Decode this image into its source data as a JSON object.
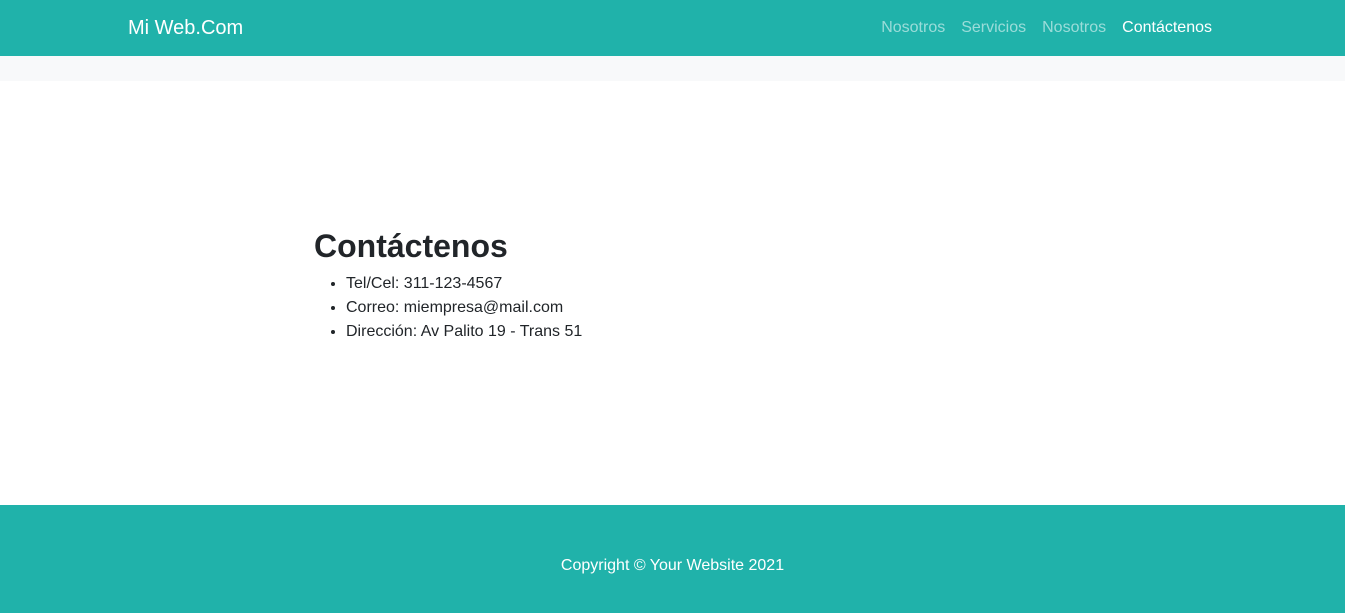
{
  "colors": {
    "brand_bar": "#20b2aa",
    "sub_bar": "#f8f9fa",
    "text": "#212529"
  },
  "navbar": {
    "brand": "Mi Web.Com",
    "links": [
      {
        "label": "Nosotros",
        "active": false
      },
      {
        "label": "Servicios",
        "active": false
      },
      {
        "label": "Nosotros",
        "active": false
      },
      {
        "label": "Contáctenos",
        "active": true
      }
    ]
  },
  "main": {
    "heading": "Contáctenos",
    "items": [
      "Tel/Cel: 311-123-4567",
      "Correo: miempresa@mail.com",
      "Dirección: Av Palito 19 - Trans 51"
    ]
  },
  "footer": {
    "copyright": "Copyright © Your Website 2021"
  }
}
